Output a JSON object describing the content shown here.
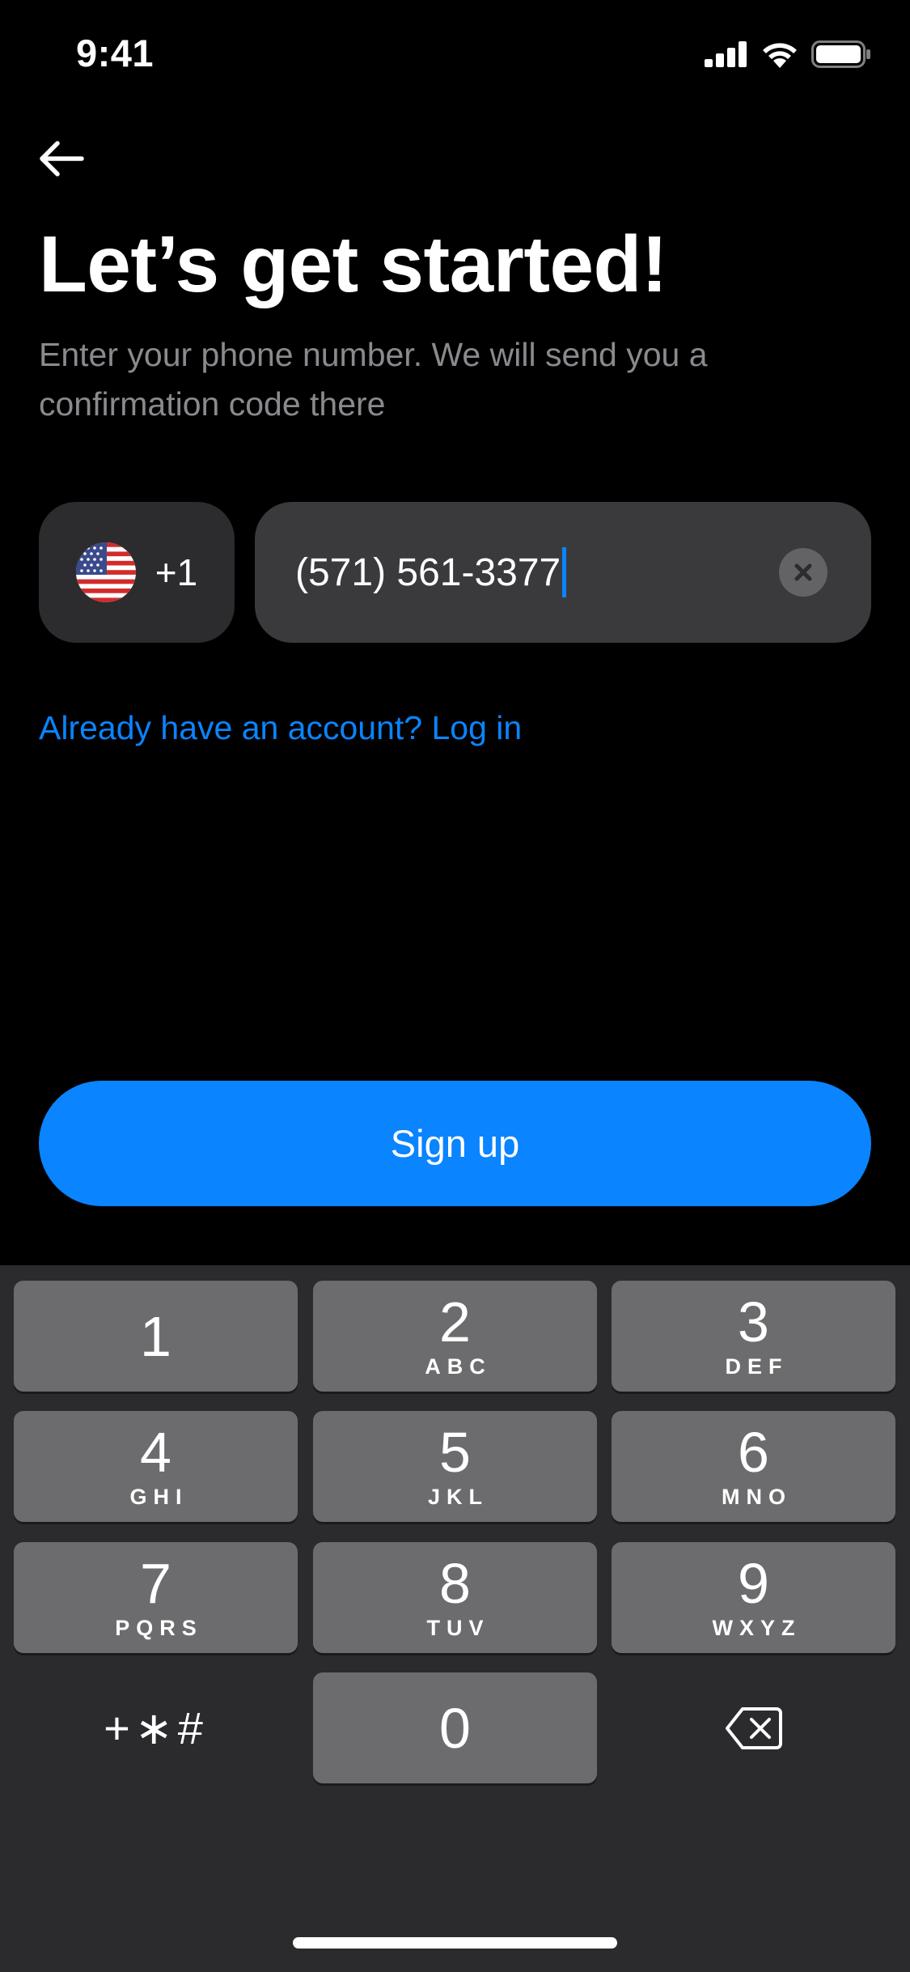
{
  "status_bar": {
    "time": "9:41"
  },
  "header": {
    "title": "Let’s get started!",
    "subtitle": "Enter your phone number. We will send you a confirmation code there"
  },
  "phone": {
    "country_code": "+1",
    "flag_icon": "us-flag-icon",
    "value": "(571) 561-3377"
  },
  "login_link": "Already have an account? Log in",
  "signup_button": "Sign up",
  "colors": {
    "accent": "#0a84ff",
    "field_bg": "#3a3a3c",
    "country_bg": "#2c2c2e",
    "key_bg": "#6c6c6e",
    "keyboard_bg": "#2b2b2d"
  },
  "keypad": {
    "keys": [
      {
        "digit": "1",
        "letters": ""
      },
      {
        "digit": "2",
        "letters": "ABC"
      },
      {
        "digit": "3",
        "letters": "DEF"
      },
      {
        "digit": "4",
        "letters": "GHI"
      },
      {
        "digit": "5",
        "letters": "JKL"
      },
      {
        "digit": "6",
        "letters": "MNO"
      },
      {
        "digit": "7",
        "letters": "PQRS"
      },
      {
        "digit": "8",
        "letters": "TUV"
      },
      {
        "digit": "9",
        "letters": "WXYZ"
      },
      {
        "digit": "0",
        "letters": ""
      }
    ],
    "symbols": "+∗#",
    "delete_icon": "backspace-icon"
  }
}
